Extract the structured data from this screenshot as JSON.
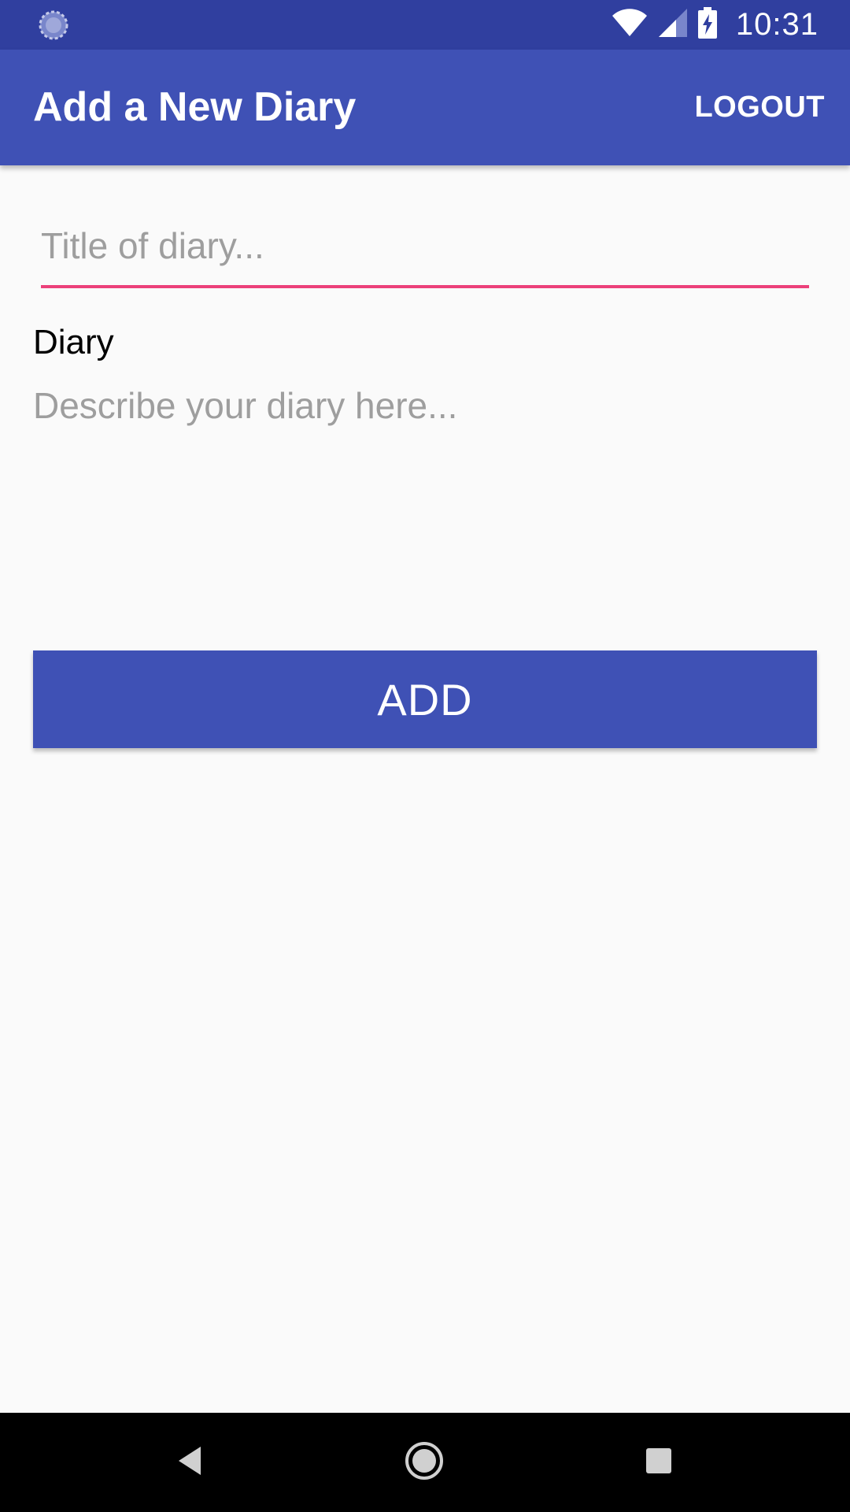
{
  "status_bar": {
    "time": "10:31",
    "left_icon": "sync-icon",
    "right_icons": [
      "wifi-icon",
      "cellular-signal-icon",
      "battery-charging-icon"
    ]
  },
  "app_bar": {
    "title": "Add a New Diary",
    "action_label": "LOGOUT"
  },
  "form": {
    "title_placeholder": "Title of diary...",
    "title_value": "",
    "diary_label": "Diary",
    "description_placeholder": "Describe your diary here...",
    "description_value": "",
    "submit_label": "ADD"
  },
  "nav_bar": {
    "buttons": [
      "back-icon",
      "home-icon",
      "recents-icon"
    ]
  },
  "colors": {
    "primary": "#3f51b5",
    "primary_dark": "#303f9f",
    "accent": "#ec407a",
    "background": "#fafafa"
  }
}
